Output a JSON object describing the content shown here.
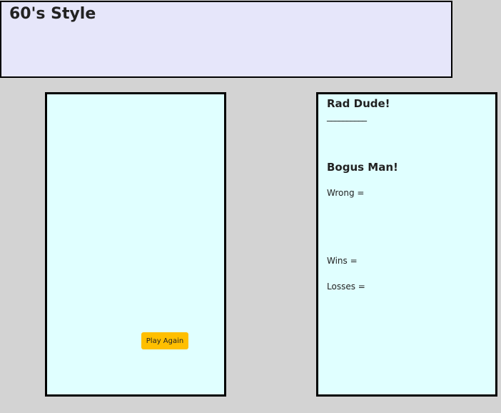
{
  "header": {
    "title": "60's Style"
  },
  "game": {
    "play_again_label": "Play Again"
  },
  "scoreboard": {
    "player_one_title": "Rad Dude!",
    "word_blanks": "__________",
    "player_two_title": "Bogus Man!",
    "wrong_label": "Wrong =",
    "wins_label": "Wins =",
    "losses_label": "Losses ="
  },
  "colors": {
    "background": "#d3d3d3",
    "header_background": "#e6e6fa",
    "panel_background": "#e0ffff",
    "button_background": "#ffbf00",
    "border": "#000000"
  }
}
